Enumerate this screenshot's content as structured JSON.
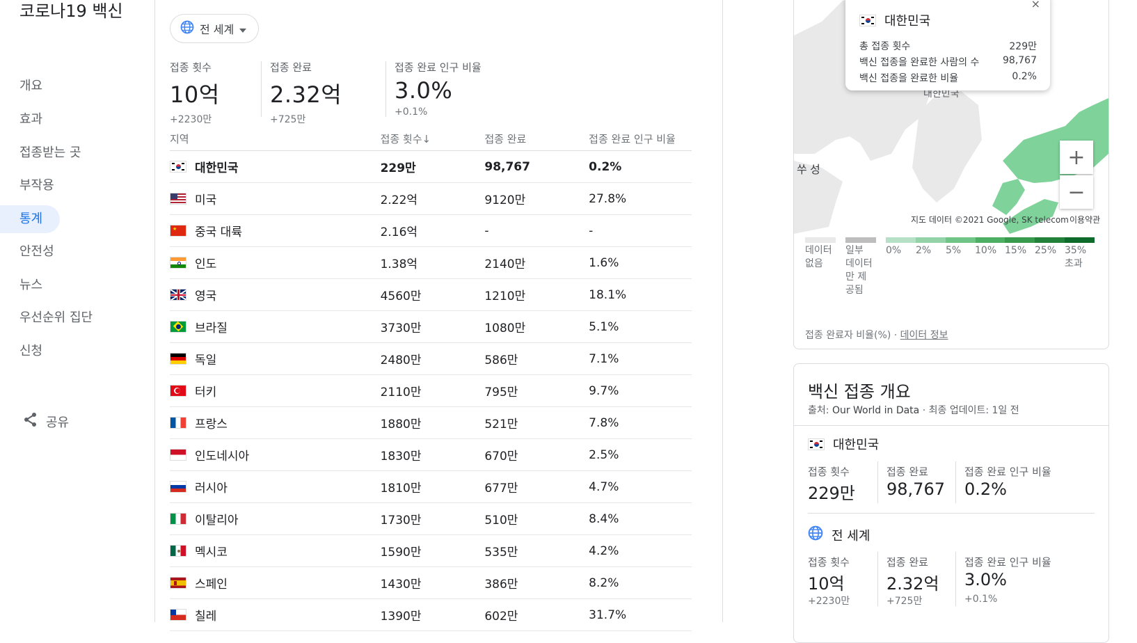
{
  "page_title": "코로나19 백신",
  "nav": {
    "items": [
      {
        "label": "개요",
        "active": false
      },
      {
        "label": "효과",
        "active": false
      },
      {
        "label": "접종받는 곳",
        "active": false
      },
      {
        "label": "부작용",
        "active": false
      },
      {
        "label": "통계",
        "active": true
      },
      {
        "label": "안전성",
        "active": false
      },
      {
        "label": "뉴스",
        "active": false
      },
      {
        "label": "우선순위 집단",
        "active": false
      },
      {
        "label": "신청",
        "active": false
      }
    ],
    "share_label": "공유"
  },
  "region_select": {
    "value": "전 세계"
  },
  "summary": [
    {
      "label": "접종 횟수",
      "value": "10억",
      "delta": "+2230만"
    },
    {
      "label": "접종 완료",
      "value": "2.32억",
      "delta": "+725만"
    },
    {
      "label": "접종 완료 인구 비율",
      "value": "3.0%",
      "delta": "+0.1%"
    }
  ],
  "table": {
    "headers": [
      "지역",
      "접종 횟수↓",
      "접종 완료",
      "접종 완료 인구 비율"
    ],
    "rows": [
      {
        "country": "대한민국",
        "doses": "229만",
        "completed": "98,767",
        "ratio": "0.2%",
        "bold": true,
        "flag": "kr"
      },
      {
        "country": "미국",
        "doses": "2.22억",
        "completed": "9120만",
        "ratio": "27.8%",
        "flag": "us"
      },
      {
        "country": "중국 대륙",
        "doses": "2.16억",
        "completed": "-",
        "ratio": "-",
        "flag": "cn"
      },
      {
        "country": "인도",
        "doses": "1.38억",
        "completed": "2140만",
        "ratio": "1.6%",
        "flag": "in"
      },
      {
        "country": "영국",
        "doses": "4560만",
        "completed": "1210만",
        "ratio": "18.1%",
        "flag": "gb"
      },
      {
        "country": "브라질",
        "doses": "3730만",
        "completed": "1080만",
        "ratio": "5.1%",
        "flag": "br"
      },
      {
        "country": "독일",
        "doses": "2480만",
        "completed": "586만",
        "ratio": "7.1%",
        "flag": "de"
      },
      {
        "country": "터키",
        "doses": "2110만",
        "completed": "795만",
        "ratio": "9.7%",
        "flag": "tr"
      },
      {
        "country": "프랑스",
        "doses": "1880만",
        "completed": "521만",
        "ratio": "7.8%",
        "flag": "fr"
      },
      {
        "country": "인도네시아",
        "doses": "1830만",
        "completed": "670만",
        "ratio": "2.5%",
        "flag": "id"
      },
      {
        "country": "러시아",
        "doses": "1810만",
        "completed": "677만",
        "ratio": "4.7%",
        "flag": "ru"
      },
      {
        "country": "이탈리아",
        "doses": "1730만",
        "completed": "510만",
        "ratio": "8.4%",
        "flag": "it"
      },
      {
        "country": "멕시코",
        "doses": "1590만",
        "completed": "535만",
        "ratio": "4.2%",
        "flag": "mx"
      },
      {
        "country": "스페인",
        "doses": "1430만",
        "completed": "386만",
        "ratio": "8.2%",
        "flag": "es"
      },
      {
        "country": "칠레",
        "doses": "1390만",
        "completed": "602만",
        "ratio": "31.7%",
        "flag": "cl"
      }
    ]
  },
  "map": {
    "tooltip": {
      "country": "대한민국",
      "rows": [
        {
          "label": "총 접종 횟수",
          "value": "229만"
        },
        {
          "label": "백신 접종을 완료한 사람의 수",
          "value": "98,767"
        },
        {
          "label": "백신 접종을 완료한 비율",
          "value": "0.2%"
        }
      ],
      "close": "×"
    },
    "map_label_korea": "대한민국",
    "map_label_west": "쑤 성",
    "attribution": "지도 데이터 ©2021 Google, SK telecom",
    "terms": "이용약관",
    "zoom_in": "+",
    "zoom_out": "−",
    "legend": {
      "no_data": "데이터 없음",
      "partial": "일부 데이터만 제공됨",
      "steps": [
        "0%",
        "2%",
        "5%",
        "10%",
        "15%",
        "25%",
        "35% 초과"
      ],
      "colors": [
        "#b7e1c7",
        "#94d3a8",
        "#6fc486",
        "#4caf63",
        "#379a4c",
        "#23823a",
        "#0f6b2b"
      ]
    },
    "footer_label": "접종 완료자 비율(%)",
    "footer_link": "데이터 정보"
  },
  "overview": {
    "title": "백신 접종 개요",
    "source_prefix": "출처:",
    "source_link": "Our World in Data",
    "updated": "· 최종 업데이트: 1일 전",
    "korea": {
      "name": "대한민국",
      "stats": [
        {
          "label": "접종 횟수",
          "value": "229만"
        },
        {
          "label": "접종 완료",
          "value": "98,767"
        },
        {
          "label": "접종 완료 인구 비율",
          "value": "0.2%"
        }
      ]
    },
    "world": {
      "name": "전 세계",
      "stats": [
        {
          "label": "접종 횟수",
          "value": "10억",
          "delta": "+2230만"
        },
        {
          "label": "접종 완료",
          "value": "2.32억",
          "delta": "+725만"
        },
        {
          "label": "접종 완료 인구 비율",
          "value": "3.0%",
          "delta": "+0.1%"
        }
      ]
    }
  },
  "colors": {
    "accent": "#1a73e8",
    "active_bg": "#e8f0fe",
    "land": "#e9e9e9",
    "sea": "#ffffff",
    "japan": "#7fd29a"
  }
}
